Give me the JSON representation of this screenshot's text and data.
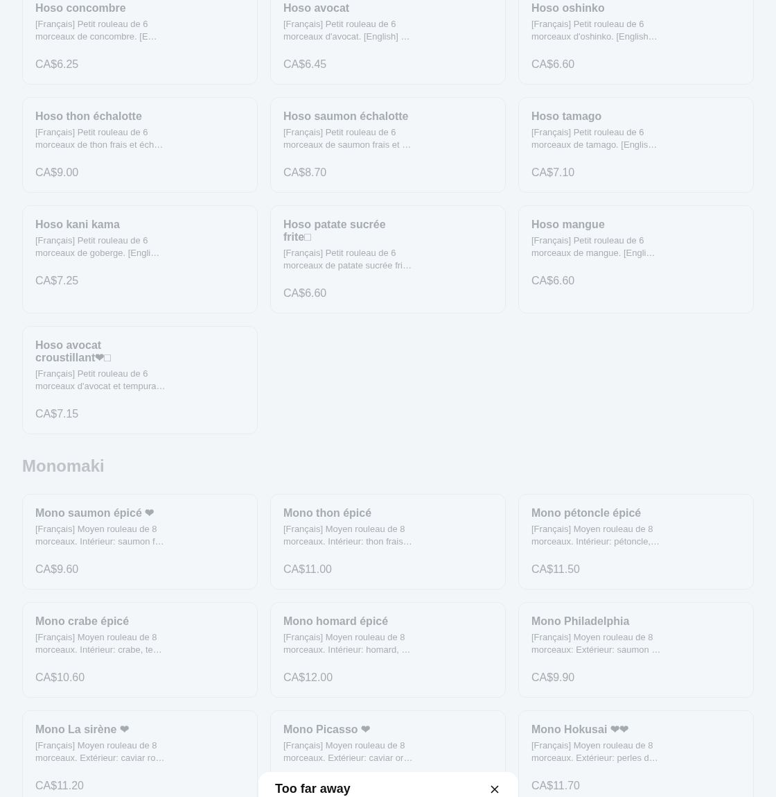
{
  "sections": [
    {
      "items": [
        {
          "name": "Hoso concombre",
          "description": "[Français] Petit rouleau de 6 morceaux de concombre. [E…",
          "price": "CA$6.25"
        },
        {
          "name": "Hoso avocat",
          "description": "[Français] Petit rouleau de 6 morceaux d'avocat. [English] …",
          "price": "CA$6.45"
        },
        {
          "name": "Hoso oshinko",
          "description": "[Français] Petit rouleau de 6 morceaux d'oshinko. [English…",
          "price": "CA$6.60"
        },
        {
          "name": "Hoso thon échalotte",
          "description": "[Français] Petit rouleau de 6 morceaux de thon frais et éch…",
          "price": "CA$9.00"
        },
        {
          "name": "Hoso saumon échalotte",
          "description": "[Français] Petit rouleau de 6 morceaux de saumon frais et …",
          "price": "CA$8.70"
        },
        {
          "name": "Hoso tamago",
          "description": "[Français] Petit rouleau de 6 morceaux de tamago. [Englis…",
          "price": "CA$7.10"
        },
        {
          "name": "Hoso kani kama",
          "description": "[Français] Petit rouleau de 6 morceaux de goberge. [Engli…",
          "price": "CA$7.25"
        },
        {
          "name": "Hoso patate sucrée frite□",
          "description": "[Français] Petit rouleau de 6 morceaux de patate sucrée fri…",
          "price": "CA$6.60"
        },
        {
          "name": "Hoso mangue",
          "description": "[Français] Petit rouleau de 6 morceaux de mangue. [Engli…",
          "price": "CA$6.60"
        },
        {
          "name": "Hoso avocat croustillant❤□",
          "description": "[Français] Petit rouleau de 6 morceaux d'avocat et tempura…",
          "price": "CA$7.15"
        }
      ]
    },
    {
      "title": "Monomaki",
      "items": [
        {
          "name": "Mono saumon épicé ❤",
          "description": "[Français] Moyen rouleau de 8 morceaux. Intérieur: saumon f…",
          "price": "CA$9.60"
        },
        {
          "name": "Mono thon épicé",
          "description": "[Français] Moyen rouleau de 8 morceaux. Intérieur: thon frais…",
          "price": "CA$11.00"
        },
        {
          "name": "Mono pétoncle épicé",
          "description": "[Français] Moyen rouleau de 8 morceaux. Intérieur: pétoncle,…",
          "price": "CA$11.50"
        },
        {
          "name": "Mono crabe épicé",
          "description": "[Français] Moyen rouleau de 8 morceaux. Intérieur: crabe, te…",
          "price": "CA$10.60"
        },
        {
          "name": "Mono homard épicé",
          "description": "[Français] Moyen rouleau de 8 morceaux. Intérieur: homard, …",
          "price": "CA$12.00"
        },
        {
          "name": "Mono Philadelphia",
          "description": "[Français] Moyen rouleau de 8 morceaux: Extérieur: saumon …",
          "price": "CA$9.90"
        },
        {
          "name": "Mono La sirène ❤",
          "description": "[Français] Moyen rouleau de 8 morceaux. Extérieur: caviar ro…",
          "price": "CA$11.20"
        },
        {
          "name": "Mono Picasso ❤",
          "description": "[Français] Moyen rouleau de 8 morceaux. Extérieur: caviar or…"
        },
        {
          "name": "Mono Hokusai ❤❤",
          "description": "[Français] Moyen rouleau de 8 morceaux. Extérieur: perles d…",
          "price": "CA$11.70"
        }
      ]
    }
  ],
  "sheet": {
    "title": "Too far away"
  }
}
